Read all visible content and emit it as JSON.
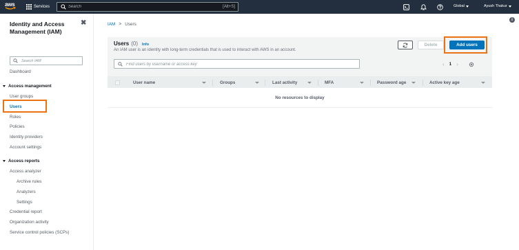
{
  "topbar": {
    "logo_text": "aws",
    "services_label": "Services",
    "search_placeholder": "Search",
    "search_shortcut": "[Alt+S]",
    "region_label": "Global",
    "account_label": "Ayush Thakur",
    "icons": [
      "cloudshell-icon",
      "bell-icon",
      "help-icon"
    ]
  },
  "sidebar": {
    "title": "Identity and Access Management (IAM)",
    "close_glyph": "✖",
    "search_placeholder": "Search IAM",
    "dashboard": "Dashboard",
    "access_management": {
      "heading": "Access management",
      "items": [
        "User groups",
        "Users",
        "Roles",
        "Policies",
        "Identity providers",
        "Account settings"
      ],
      "active": "Users"
    },
    "access_reports": {
      "heading": "Access reports",
      "items": [
        "Access analyzer",
        "Archive rules",
        "Analyzers",
        "Settings",
        "Credential report",
        "Organization activity",
        "Service control policies (SCPs)"
      ]
    }
  },
  "breadcrumb": {
    "root": "IAM",
    "separator": ">",
    "current": "Users"
  },
  "users_panel": {
    "title": "Users",
    "count": "(0)",
    "info_link": "Info",
    "description": "An IAM user is an identity with long-term credentials that is used to interact with AWS in an account.",
    "delete_label": "Delete",
    "add_label": "Add users",
    "find_placeholder": "Find users by username or access key",
    "page_number": "1",
    "columns": [
      "User name",
      "Groups",
      "Last activity",
      "MFA",
      "Password age",
      "Active key age"
    ],
    "empty_message": "No resources to display"
  },
  "colors": {
    "nav_bg": "#232f3e",
    "primary_button": "#0073bb",
    "highlight_box": "#ec7211",
    "link": "#0073bb"
  }
}
